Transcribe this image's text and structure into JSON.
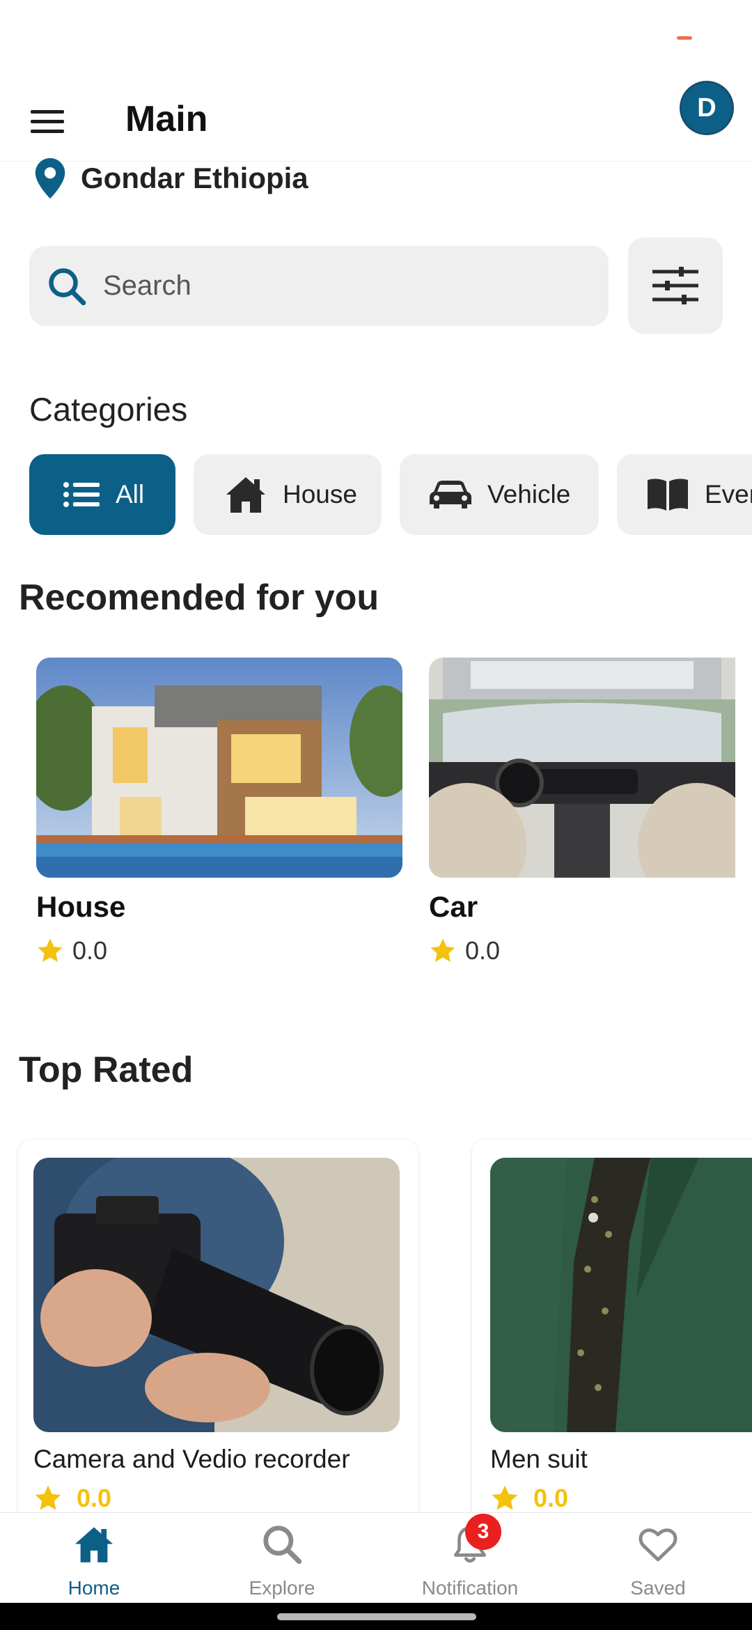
{
  "app_bar": {
    "title": "Main",
    "avatar_letter": "D"
  },
  "location": {
    "text": "Gondar Ethiopia",
    "icon": "map-pin-icon"
  },
  "search": {
    "placeholder": "Search",
    "value": ""
  },
  "categories": {
    "title": "Categories",
    "items": [
      {
        "label": "All",
        "icon": "list-icon",
        "active": true
      },
      {
        "label": "House",
        "icon": "house-icon",
        "active": false
      },
      {
        "label": "Vehicle",
        "icon": "car-icon",
        "active": false
      },
      {
        "label": "Ever",
        "icon": "book-icon",
        "active": false
      }
    ]
  },
  "recommended": {
    "title": "Recomended for you",
    "items": [
      {
        "name": "House",
        "rating": "0.0",
        "image": "modern-house-photo"
      },
      {
        "name": "Car",
        "rating": "0.0",
        "image": "car-interior-photo"
      }
    ]
  },
  "top_rated": {
    "title": "Top Rated",
    "items": [
      {
        "name": "Camera and Vedio recorder",
        "rating": "0.0",
        "image": "camera-photo"
      },
      {
        "name": "Men suit",
        "rating": "0.0",
        "image": "green-suit-photo"
      }
    ]
  },
  "bottom_nav": {
    "items": [
      {
        "label": "Home",
        "icon": "home-icon",
        "active": true
      },
      {
        "label": "Explore",
        "icon": "search-icon",
        "active": false
      },
      {
        "label": "Notification",
        "icon": "bell-icon",
        "active": false
      },
      {
        "label": "Saved",
        "icon": "heart-icon",
        "active": false
      }
    ],
    "notification_count": "3"
  },
  "colors": {
    "primary": "#0c6088",
    "star": "#f4c20d",
    "badge": "#e8201f",
    "chip_bg": "#efefef"
  }
}
